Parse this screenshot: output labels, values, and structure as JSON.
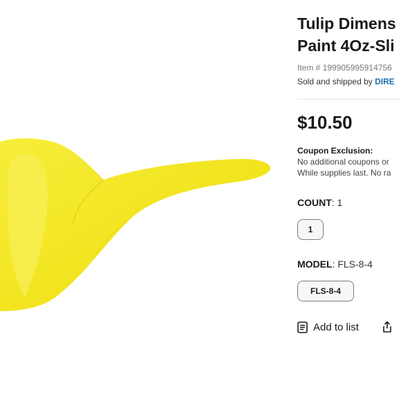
{
  "product": {
    "title_line1": "Tulip Dimens",
    "title_line2": "Paint 4Oz-Sli",
    "item_number": "Item # 199905995914756",
    "sold_prefix": "Sold and shipped by ",
    "seller": "DIRE",
    "price": "$10.50",
    "image_color": "#f2e520"
  },
  "coupon": {
    "heading": "Coupon Exclusion:",
    "line1": "No additional coupons or",
    "line2": "While supplies last. No ra"
  },
  "options": {
    "count": {
      "label": "COUNT",
      "value": ": 1",
      "chip": "1"
    },
    "model": {
      "label": "MODEL",
      "value": ": FLS-8-4",
      "chip": "FLS-8-4"
    }
  },
  "actions": {
    "add_to_list": "Add to list",
    "list_icon": "list-icon",
    "share_icon": "share-icon"
  },
  "colors": {
    "seller_link": "#1a6fb0",
    "chip_border": "#7d7d7d"
  }
}
